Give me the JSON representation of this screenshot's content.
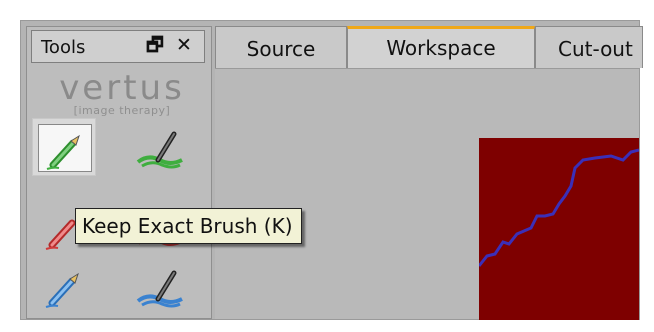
{
  "tools_panel": {
    "title": "Tools",
    "restore_glyph": "🗗",
    "close_glyph": "✕",
    "logo": {
      "main": "vertus",
      "sub": "[image therapy]"
    },
    "tools": [
      {
        "name": "keep-exact-brush",
        "icon": "pencil-icon",
        "color": "#3fae3f",
        "selected": true
      },
      {
        "name": "keep-brush",
        "icon": "brush-icon",
        "color": "#3fae3f",
        "selected": false
      },
      {
        "name": "remove-exact-brush",
        "icon": "pencil-icon",
        "color": "#d03a3a",
        "selected": false
      },
      {
        "name": "remove-brush",
        "icon": "brush-icon",
        "color": "#d03a3a",
        "selected": false
      },
      {
        "name": "blue-exact-brush",
        "icon": "pencil-icon",
        "color": "#3a82d0",
        "selected": false
      },
      {
        "name": "blue-brush",
        "icon": "brush-icon",
        "color": "#3a82d0",
        "selected": false
      }
    ]
  },
  "tabs": [
    {
      "label": "Source",
      "active": false
    },
    {
      "label": "Workspace",
      "active": true
    },
    {
      "label": "Cut-out",
      "active": false
    }
  ],
  "tooltip": {
    "text": "Keep Exact Brush (K)"
  },
  "workspace": {
    "image_color": "#7e0000",
    "stroke_color": "#3b2fb8"
  },
  "colors": {
    "tab_active_accent": "#f0a818"
  }
}
